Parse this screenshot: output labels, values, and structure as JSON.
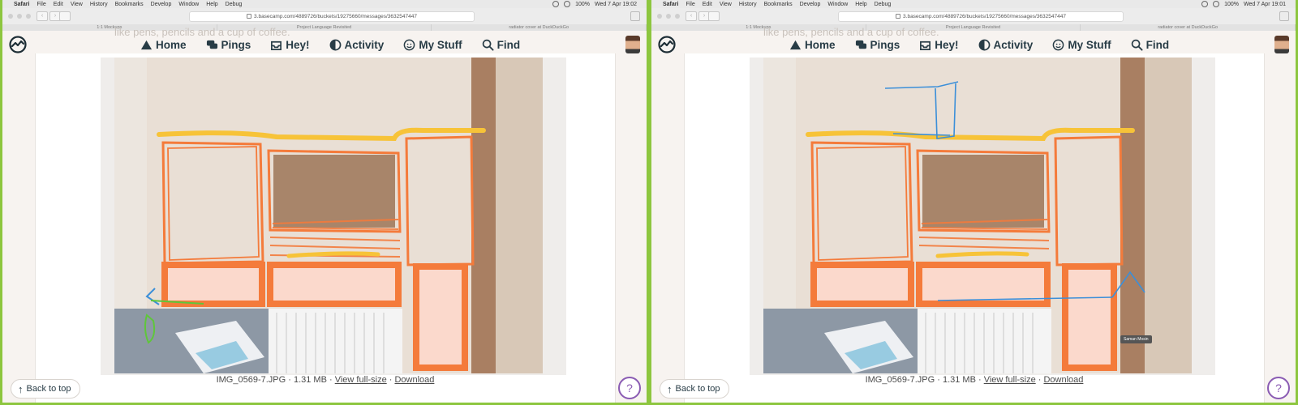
{
  "menubar": {
    "app": "Safari",
    "items": [
      "File",
      "Edit",
      "View",
      "History",
      "Bookmarks",
      "Develop",
      "Window",
      "Help",
      "Debug"
    ],
    "battery": "100%"
  },
  "screens": [
    {
      "clock": "Wed 7 Apr 19:02",
      "url": "3.basecamp.com/4889726/buckets/19275660/messages/3632547447",
      "tabs": [
        "1:1 Mockups",
        "Project Language Revisited",
        "radiator cover at DuckDuckGo"
      ],
      "ghost_text": "like pens, pencils and a cup of coffee.",
      "nav": [
        "Home",
        "Pings",
        "Hey!",
        "Activity",
        "My Stuff",
        "Find"
      ],
      "caption": {
        "filename": "IMG_0569-7.JPG",
        "size": "1.31 MB",
        "view": "View full-size",
        "download": "Download"
      },
      "back_to_top": "Back to top",
      "help": "?"
    },
    {
      "clock": "Wed 7 Apr 19:01",
      "url": "3.basecamp.com/4889726/buckets/19275660/messages/3632547447",
      "tabs": [
        "1:1 Mockups",
        "Project Language Revisited",
        "radiator cover at DuckDuckGo"
      ],
      "ghost_text": "like pens, pencils and a cup of coffee.",
      "nav": [
        "Home",
        "Pings",
        "Hey!",
        "Activity",
        "My Stuff",
        "Find"
      ],
      "caption": {
        "filename": "IMG_0569-7.JPG",
        "size": "1.31 MB",
        "view": "View full-size",
        "download": "Download"
      },
      "back_to_top": "Back to top",
      "help": "?",
      "tooltip": "Saman Mosin"
    }
  ],
  "colors": {
    "accent_frame": "#8dc63f",
    "sketch_orange": "#f47b3b",
    "sketch_yellow": "#f7c338",
    "sketch_blue": "#3b8fd9",
    "sketch_green": "#5fc63b",
    "help_purple": "#8a5bb3"
  },
  "icons": [
    "apple-icon",
    "home-icon",
    "pings-icon",
    "hey-icon",
    "activity-icon",
    "mystuff-icon",
    "find-icon",
    "arrow-up-icon",
    "basecamp-logo-icon"
  ]
}
